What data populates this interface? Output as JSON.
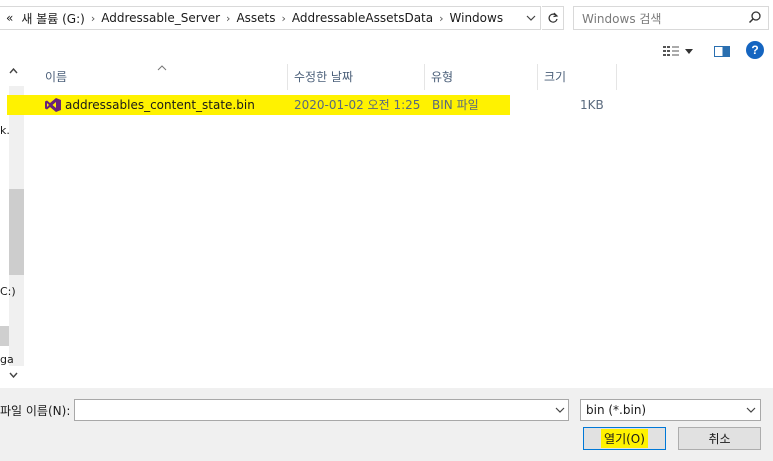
{
  "address_bar": {
    "overflow": "«",
    "crumbs": [
      "새 볼륨 (G:)",
      "Addressable_Server",
      "Assets",
      "AddressableAssetsData",
      "Windows"
    ],
    "separator": "›",
    "dropdown_icon": "chevron-down-icon",
    "refresh_icon": "refresh-icon"
  },
  "search": {
    "placeholder": "Windows 검색",
    "icon": "search-icon"
  },
  "toolbar": {
    "view_icon": "view-options-icon",
    "preview_icon": "preview-pane-icon",
    "help_label": "?"
  },
  "nav_pane": {
    "fragments": [
      "k.",
      "C:)",
      "ga"
    ]
  },
  "file_list": {
    "columns": [
      "이름",
      "수정한 날짜",
      "유형",
      "크기"
    ],
    "sorted_column": "이름",
    "rows": [
      {
        "name": "addressables_content_state.bin",
        "modified": "2020-01-02 오전 1:25",
        "type": "BIN 파일",
        "size": "1KB",
        "icon": "visual-studio-icon",
        "highlighted": true
      }
    ],
    "highlight_color": "#fff200"
  },
  "bottom": {
    "filename_label": "파일 이름(N):",
    "filename_value": "",
    "filter_value": "bin (*.bin)",
    "open_label": "열기(O)",
    "cancel_label": "취소"
  },
  "colors": {
    "accent": "#0078d7",
    "help_blue": "#1565c0",
    "header_text": "#4c607a"
  }
}
